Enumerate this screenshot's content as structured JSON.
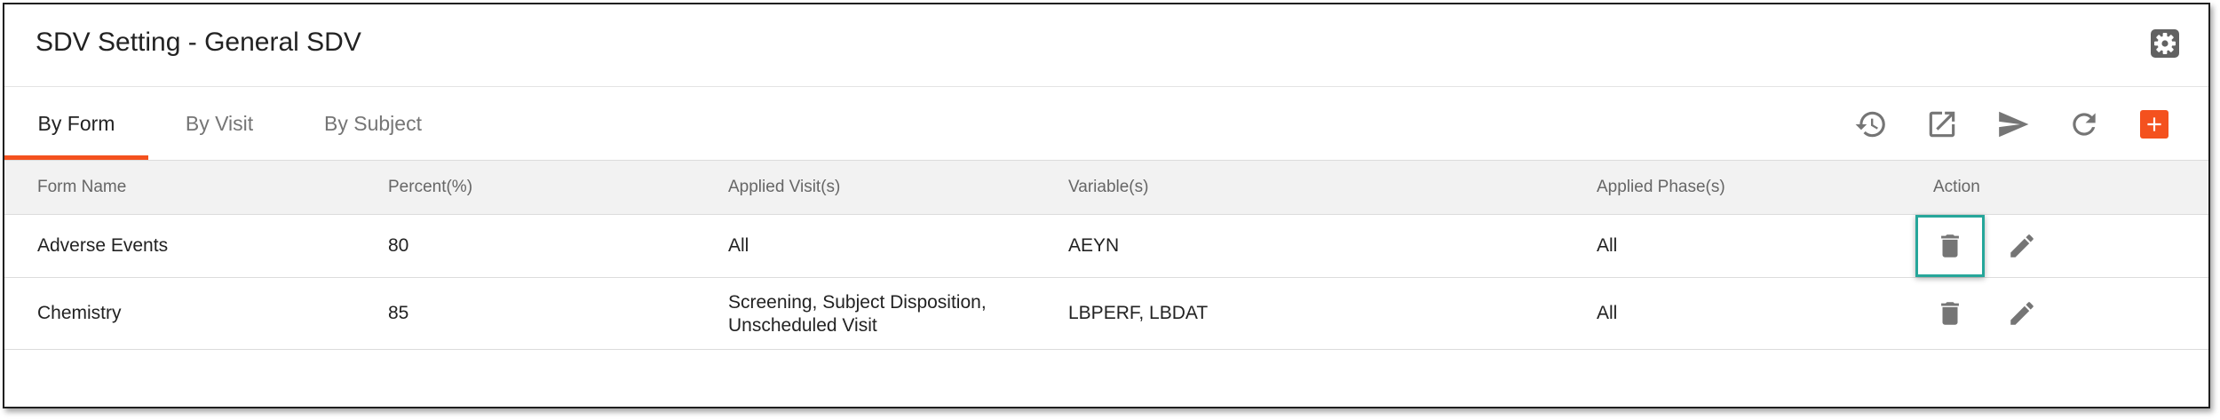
{
  "header": {
    "title": "SDV Setting - General SDV",
    "settings_icon": "gear-icon"
  },
  "tabs": [
    {
      "label": "By Form",
      "active": true
    },
    {
      "label": "By Visit",
      "active": false
    },
    {
      "label": "By Subject",
      "active": false
    }
  ],
  "toolbar": {
    "icons": [
      "history-icon",
      "open-in-new-icon",
      "send-icon",
      "refresh-icon",
      "add-icon"
    ]
  },
  "colors": {
    "accent": "#f4511e",
    "highlight": "#26a69a",
    "icon": "#757575"
  },
  "table": {
    "columns": [
      "Form Name",
      "Percent(%)",
      "Applied Visit(s)",
      "Variable(s)",
      "Applied Phase(s)",
      "Action"
    ],
    "rows": [
      {
        "form_name": "Adverse Events",
        "percent": "80",
        "visits_line1": "All",
        "visits_line2": "",
        "variables": "AEYN",
        "phases": "All"
      },
      {
        "form_name": "Chemistry",
        "percent": "85",
        "visits_line1": "Screening, Subject Disposition,",
        "visits_line2": "Unscheduled Visit",
        "variables": "LBPERF, LBDAT",
        "phases": "All"
      }
    ]
  }
}
